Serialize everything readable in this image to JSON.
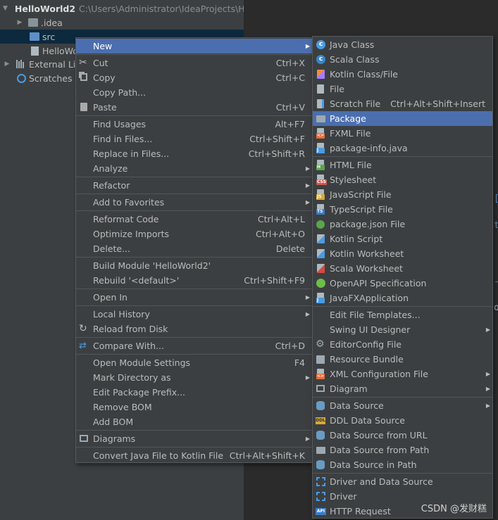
{
  "tree": {
    "project_name": "HelloWorld2",
    "project_path": "C:\\Users\\Administrator\\IdeaProjects\\H",
    "items": [
      {
        "label": ".idea"
      },
      {
        "label": "src"
      },
      {
        "label": "HelloWo"
      },
      {
        "label": "External Lib"
      },
      {
        "label": "Scratches a"
      }
    ]
  },
  "main_menu": {
    "items": [
      {
        "label": "New",
        "shortcut": "",
        "submenu": true
      },
      {
        "label": "Cut",
        "shortcut": "Ctrl+X",
        "icon": "scissors-icon"
      },
      {
        "label": "Copy",
        "shortcut": "Ctrl+C",
        "icon": "copy-icon"
      },
      {
        "label": "Copy Path...",
        "shortcut": ""
      },
      {
        "label": "Paste",
        "shortcut": "Ctrl+V",
        "icon": "clipboard-icon"
      },
      {
        "label": "Find Usages",
        "shortcut": "Alt+F7"
      },
      {
        "label": "Find in Files...",
        "shortcut": "Ctrl+Shift+F"
      },
      {
        "label": "Replace in Files...",
        "shortcut": "Ctrl+Shift+R"
      },
      {
        "label": "Analyze",
        "shortcut": "",
        "submenu": true
      },
      {
        "label": "Refactor",
        "shortcut": "",
        "submenu": true
      },
      {
        "label": "Add to Favorites",
        "shortcut": "",
        "submenu": true
      },
      {
        "label": "Reformat Code",
        "shortcut": "Ctrl+Alt+L"
      },
      {
        "label": "Optimize Imports",
        "shortcut": "Ctrl+Alt+O"
      },
      {
        "label": "Delete...",
        "shortcut": "Delete"
      },
      {
        "label": "Build Module 'HelloWorld2'",
        "shortcut": ""
      },
      {
        "label": "Rebuild '<default>'",
        "shortcut": "Ctrl+Shift+F9"
      },
      {
        "label": "Open In",
        "shortcut": "",
        "submenu": true
      },
      {
        "label": "Local History",
        "shortcut": "",
        "submenu": true
      },
      {
        "label": "Reload from Disk",
        "shortcut": "",
        "icon": "reload-icon"
      },
      {
        "label": "Compare With...",
        "shortcut": "Ctrl+D",
        "icon": "compare-icon"
      },
      {
        "label": "Open Module Settings",
        "shortcut": "F4"
      },
      {
        "label": "Mark Directory as",
        "shortcut": "",
        "submenu": true
      },
      {
        "label": "Edit Package Prefix...",
        "shortcut": ""
      },
      {
        "label": "Remove BOM",
        "shortcut": ""
      },
      {
        "label": "Add BOM",
        "shortcut": ""
      },
      {
        "label": "Diagrams",
        "shortcut": "",
        "submenu": true,
        "icon": "diagram-icon"
      },
      {
        "label": "Convert Java File to Kotlin File",
        "shortcut": "Ctrl+Alt+Shift+K"
      }
    ]
  },
  "sub_menu": {
    "items": [
      {
        "label": "Java Class",
        "shortcut": "",
        "icon": "java-class-icon"
      },
      {
        "label": "Scala Class",
        "shortcut": "",
        "icon": "scala-class-icon"
      },
      {
        "label": "Kotlin Class/File",
        "shortcut": "",
        "icon": "kotlin-file-icon"
      },
      {
        "label": "File",
        "shortcut": "",
        "icon": "file-icon"
      },
      {
        "label": "Scratch File",
        "shortcut": "Ctrl+Alt+Shift+Insert",
        "icon": "scratch-file-icon"
      },
      {
        "label": "Package",
        "shortcut": "",
        "icon": "package-icon"
      },
      {
        "label": "FXML File",
        "shortcut": "",
        "icon": "fxml-file-icon"
      },
      {
        "label": "package-info.java",
        "shortcut": "",
        "icon": "java-file-icon"
      },
      {
        "label": "HTML File",
        "shortcut": "",
        "icon": "html-file-icon"
      },
      {
        "label": "Stylesheet",
        "shortcut": "",
        "icon": "css-file-icon"
      },
      {
        "label": "JavaScript File",
        "shortcut": "",
        "icon": "js-file-icon"
      },
      {
        "label": "TypeScript File",
        "shortcut": "",
        "icon": "ts-file-icon"
      },
      {
        "label": "package.json File",
        "shortcut": "",
        "icon": "npm-file-icon"
      },
      {
        "label": "Kotlin Script",
        "shortcut": "",
        "icon": "kotlin-script-icon"
      },
      {
        "label": "Kotlin Worksheet",
        "shortcut": "",
        "icon": "kotlin-worksheet-icon"
      },
      {
        "label": "Scala Worksheet",
        "shortcut": "",
        "icon": "scala-worksheet-icon"
      },
      {
        "label": "OpenAPI Specification",
        "shortcut": "",
        "icon": "openapi-icon"
      },
      {
        "label": "JavaFXApplication",
        "shortcut": "",
        "icon": "javafx-icon"
      },
      {
        "label": "Edit File Templates...",
        "shortcut": ""
      },
      {
        "label": "Swing UI Designer",
        "shortcut": "",
        "submenu": true
      },
      {
        "label": "EditorConfig File",
        "shortcut": "",
        "icon": "gear-icon"
      },
      {
        "label": "Resource Bundle",
        "shortcut": "",
        "icon": "resource-bundle-icon"
      },
      {
        "label": "XML Configuration File",
        "shortcut": "",
        "submenu": true,
        "icon": "xml-file-icon"
      },
      {
        "label": "Diagram",
        "shortcut": "",
        "submenu": true,
        "icon": "diagram-icon"
      },
      {
        "label": "Data Source",
        "shortcut": "",
        "submenu": true,
        "icon": "database-icon"
      },
      {
        "label": "DDL Data Source",
        "shortcut": "",
        "icon": "ddl-icon"
      },
      {
        "label": "Data Source from URL",
        "shortcut": "",
        "icon": "database-url-icon"
      },
      {
        "label": "Data Source from Path",
        "shortcut": "",
        "icon": "folder-icon"
      },
      {
        "label": "Data Source in Path",
        "shortcut": "",
        "icon": "database-path-icon"
      },
      {
        "label": "Driver and Data Source",
        "shortcut": "",
        "icon": "driver-datasource-icon"
      },
      {
        "label": "Driver",
        "shortcut": "",
        "icon": "driver-icon"
      },
      {
        "label": "HTTP Request",
        "shortcut": "",
        "icon": "api-icon"
      }
    ]
  },
  "editor": {
    "fragments": [
      "[",
      "t",
      "-",
      "o"
    ]
  },
  "watermark": "CSDN @发财糕"
}
